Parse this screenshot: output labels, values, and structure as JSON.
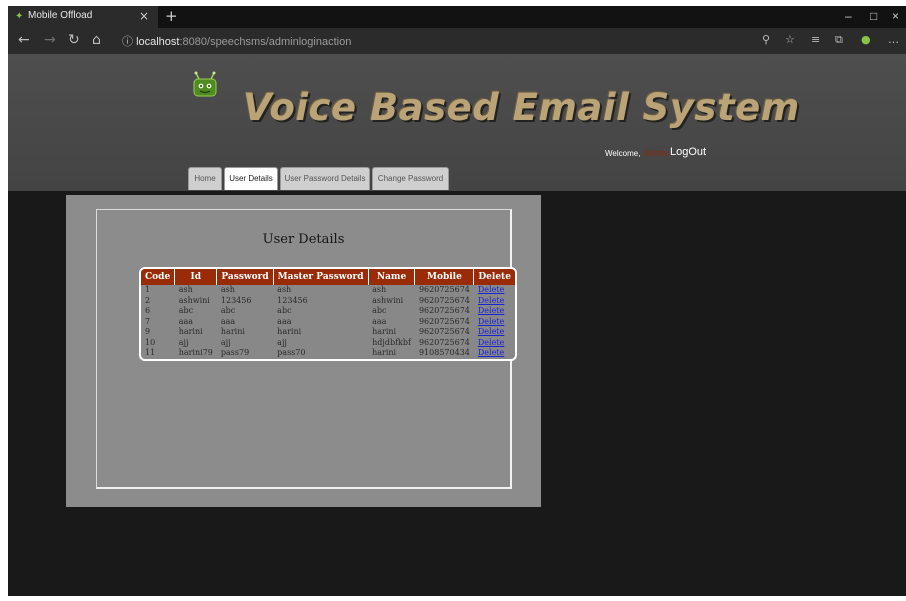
{
  "browser": {
    "tab_title": "Mobile Offload",
    "tab_close": "×",
    "new_tab": "+",
    "url_host": "localhost",
    "url_path": ":8080/speechsms/adminloginaction",
    "win_minimize": "–",
    "win_maximize": "□",
    "win_close": "×"
  },
  "header": {
    "site_title": "Voice Based Email System",
    "welcome": "Welcome,",
    "admin_name": "Admin",
    "logout": "LogOut"
  },
  "menu": {
    "home": "Home",
    "user_details": "User Details",
    "user_password_details": "User Password Details",
    "change_password": "Change Password"
  },
  "main": {
    "section_title": "User Details",
    "columns": {
      "code": "Code",
      "id": "Id",
      "password": "Password",
      "master_password": "Master Password",
      "name": "Name",
      "mobile": "Mobile",
      "delete": "Delete"
    },
    "rows": [
      {
        "code": "1",
        "id": "ash",
        "password": "ash",
        "master_password": "ash",
        "name": "ash",
        "mobile": "9620725674",
        "delete": "Delete"
      },
      {
        "code": "2",
        "id": "ashwini",
        "password": "123456",
        "master_password": "123456",
        "name": "ashwini",
        "mobile": "9620725674",
        "delete": "Delete"
      },
      {
        "code": "6",
        "id": "abc",
        "password": "abc",
        "master_password": "abc",
        "name": "abc",
        "mobile": "9620725674",
        "delete": "Delete"
      },
      {
        "code": "7",
        "id": "aaa",
        "password": "aaa",
        "master_password": "aaa",
        "name": "aaa",
        "mobile": "9620725674",
        "delete": "Delete"
      },
      {
        "code": "9",
        "id": "harini",
        "password": "harini",
        "master_password": "harini",
        "name": "harini",
        "mobile": "9620725674",
        "delete": "Delete"
      },
      {
        "code": "10",
        "id": "ajj",
        "password": "ajj",
        "master_password": "ajj",
        "name": "hdjdbfkbf",
        "mobile": "9620725674",
        "delete": "Delete"
      },
      {
        "code": "11",
        "id": "harini79",
        "password": "pass79",
        "master_password": "pass70",
        "name": "harini",
        "mobile": "9108570434",
        "delete": "Delete"
      }
    ]
  }
}
